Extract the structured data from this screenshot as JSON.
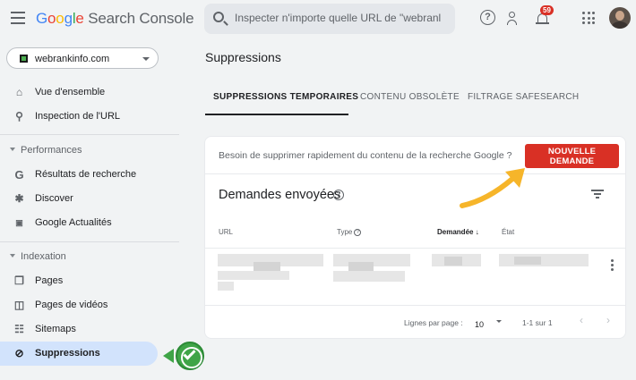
{
  "header": {
    "logo_google": [
      "G",
      "o",
      "o",
      "g",
      "l",
      "e"
    ],
    "logo_product": "Search Console",
    "search_placeholder": "Inspecter n'importe quelle URL de \"webranl",
    "notification_count": "59"
  },
  "sidebar": {
    "property": "webrankinfo.com",
    "top_items": [
      {
        "label": "Vue d'ensemble",
        "icon": "home-icon"
      },
      {
        "label": "Inspection de l'URL",
        "icon": "search-icon"
      }
    ],
    "sections": [
      {
        "title": "Performances",
        "items": [
          {
            "label": "Résultats de recherche",
            "icon": "google-g-icon"
          },
          {
            "label": "Discover",
            "icon": "asterisk-icon"
          },
          {
            "label": "Google Actualités",
            "icon": "news-icon"
          }
        ]
      },
      {
        "title": "Indexation",
        "items": [
          {
            "label": "Pages",
            "icon": "pages-icon"
          },
          {
            "label": "Pages de vidéos",
            "icon": "video-pages-icon"
          },
          {
            "label": "Sitemaps",
            "icon": "sitemap-icon"
          },
          {
            "label": "Suppressions",
            "icon": "eye-off-icon",
            "active": true
          }
        ]
      }
    ]
  },
  "main": {
    "title": "Suppressions",
    "tabs": [
      {
        "label": "SUPPRESSIONS TEMPORAIRES",
        "active": true
      },
      {
        "label": "CONTENU OBSOLÈTE",
        "active": false
      },
      {
        "label": "FILTRAGE SAFESEARCH",
        "active": false
      }
    ],
    "card": {
      "prompt": "Besoin de supprimer rapidement du contenu de la recherche Google ?",
      "new_request_button": "NOUVELLE DEMANDE",
      "requests_title": "Demandes envoyées",
      "columns": {
        "url": "URL",
        "type": "Type",
        "requested": "Demandée",
        "state": "État"
      },
      "pagination": {
        "rows_per_page_label": "Lignes par page :",
        "rows_per_page_value": "10",
        "range": "1-1 sur 1"
      }
    }
  },
  "colors": {
    "accent_red": "#d93025",
    "active_nav": "#d2e3fc",
    "callout_green": "#3fa447",
    "arrow_yellow": "#f6b52a"
  }
}
